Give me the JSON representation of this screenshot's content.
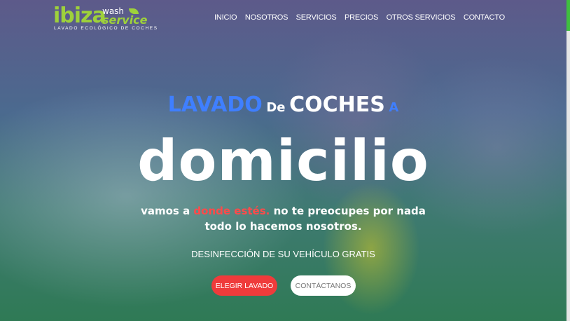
{
  "logo": {
    "brand": "ibiza",
    "wash": "wash",
    "service": "service",
    "tagline": "LAVADO ECOLÓGICO DE COCHES"
  },
  "nav": {
    "items": [
      "INICIO",
      "NOSOTROS",
      "SERVICIOS",
      "PRECIOS",
      "OTROS SERVICIOS",
      "CONTACTO"
    ]
  },
  "hero": {
    "line1_word1": "LAVADO",
    "line1_word2": "De",
    "line1_word3": "COCHES",
    "line1_word4": "A",
    "line2": "DOMICILIO",
    "tagline_part1": "vamos a ",
    "tagline_highlight": "donde estés.",
    "tagline_part2": " no te preocupes por nada",
    "tagline_line2": "todo lo hacemos nosotros.",
    "promo": "DESINFECCIÓN DE SU VEHÍCULO GRATIS",
    "primary_button": "ELEGIR LAVADO",
    "secondary_button": "CONTÁCTANOS"
  },
  "colors": {
    "accent_blue": "#3f7fff",
    "accent_red": "#ef3b3b",
    "brand_green": "#9ed13b",
    "scroll_thumb": "#3fbf3f"
  }
}
